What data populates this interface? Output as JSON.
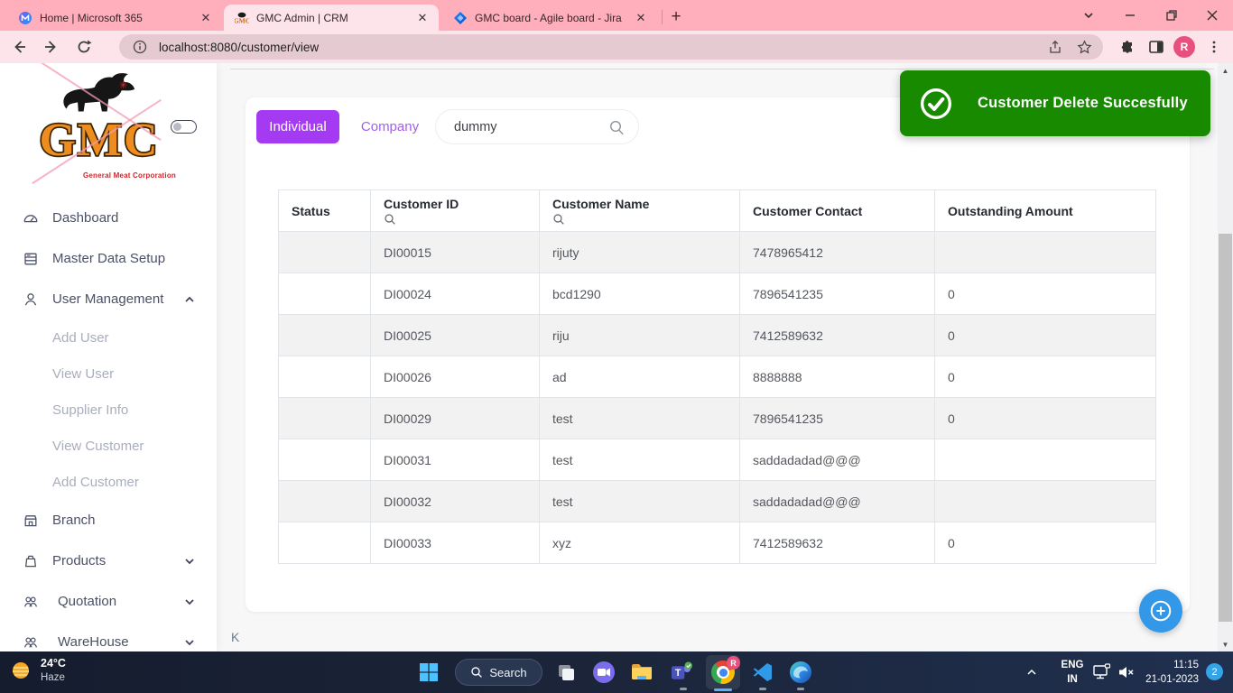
{
  "browser": {
    "tabs": [
      {
        "title": "Home | Microsoft 365",
        "icon": "microsoft-365-icon",
        "active": false
      },
      {
        "title": "GMC Admin | CRM",
        "icon": "gmc-favicon",
        "active": true
      },
      {
        "title": "GMC board - Agile board - Jira",
        "icon": "jira-icon",
        "active": false
      }
    ],
    "address": "localhost:8080/customer/view",
    "profile_initial": "R"
  },
  "sidebar": {
    "logo_text": "GMC",
    "logo_subtext": "General Meat Corporation",
    "items": [
      {
        "label": "Dashboard",
        "icon": "dashboard-icon",
        "type": "item"
      },
      {
        "label": "Master Data Setup",
        "icon": "master-data-icon",
        "type": "item"
      },
      {
        "label": "User Management",
        "icon": "user-icon",
        "type": "item",
        "chevron": "up"
      },
      {
        "label": "Add User",
        "type": "subitem"
      },
      {
        "label": "View User",
        "type": "subitem"
      },
      {
        "label": "Supplier Info",
        "type": "subitem"
      },
      {
        "label": "View Customer",
        "type": "subitem"
      },
      {
        "label": "Add Customer",
        "type": "subitem"
      },
      {
        "label": "Branch",
        "icon": "branch-icon",
        "type": "item"
      },
      {
        "label": "Products",
        "icon": "products-icon",
        "type": "item",
        "chevron": "down"
      },
      {
        "label": "Quotation",
        "icon": "quotation-icon",
        "type": "item",
        "chevron": "down",
        "indent": true
      },
      {
        "label": "WareHouse",
        "icon": "warehouse-icon",
        "type": "item",
        "chevron": "down",
        "indent": true
      }
    ]
  },
  "main": {
    "filters": {
      "individual": "Individual",
      "company": "Company"
    },
    "search": {
      "value": "dummy"
    },
    "toast": {
      "message": "Customer Delete Succesfully"
    },
    "stray_text": "K",
    "table": {
      "columns": [
        {
          "label": "Status",
          "searchable": false
        },
        {
          "label": "Customer ID",
          "searchable": true
        },
        {
          "label": "Customer Name",
          "searchable": true
        },
        {
          "label": "Customer Contact",
          "searchable": false
        },
        {
          "label": "Outstanding Amount",
          "searchable": false
        }
      ],
      "rows": [
        {
          "status": "",
          "id": "DI00015",
          "name": "rijuty",
          "contact": "7478965412",
          "outstanding": ""
        },
        {
          "status": "",
          "id": "DI00024",
          "name": "bcd1290",
          "contact": "7896541235",
          "outstanding": "0"
        },
        {
          "status": "",
          "id": "DI00025",
          "name": "riju",
          "contact": "7412589632",
          "outstanding": "0"
        },
        {
          "status": "",
          "id": "DI00026",
          "name": "ad",
          "contact": "8888888",
          "outstanding": "0"
        },
        {
          "status": "",
          "id": "DI00029",
          "name": "test",
          "contact": "7896541235",
          "outstanding": "0"
        },
        {
          "status": "",
          "id": "DI00031",
          "name": "test",
          "contact": "saddadadad@@@",
          "outstanding": ""
        },
        {
          "status": "",
          "id": "DI00032",
          "name": "test",
          "contact": "saddadadad@@@",
          "outstanding": ""
        },
        {
          "status": "",
          "id": "DI00033",
          "name": "xyz",
          "contact": "7412589632",
          "outstanding": "0"
        }
      ]
    }
  },
  "taskbar": {
    "weather": {
      "temp": "24°C",
      "condition": "Haze"
    },
    "search_label": "Search",
    "tray": {
      "lang_line1": "ENG",
      "lang_line2": "IN",
      "time": "11:15",
      "date": "21-01-2023",
      "badge_count": "2"
    }
  },
  "colors": {
    "accent_purple": "#a43bf2",
    "toast_green": "#178a00",
    "fab_blue": "#3498e8",
    "frame_pink": "#ffaebb"
  }
}
